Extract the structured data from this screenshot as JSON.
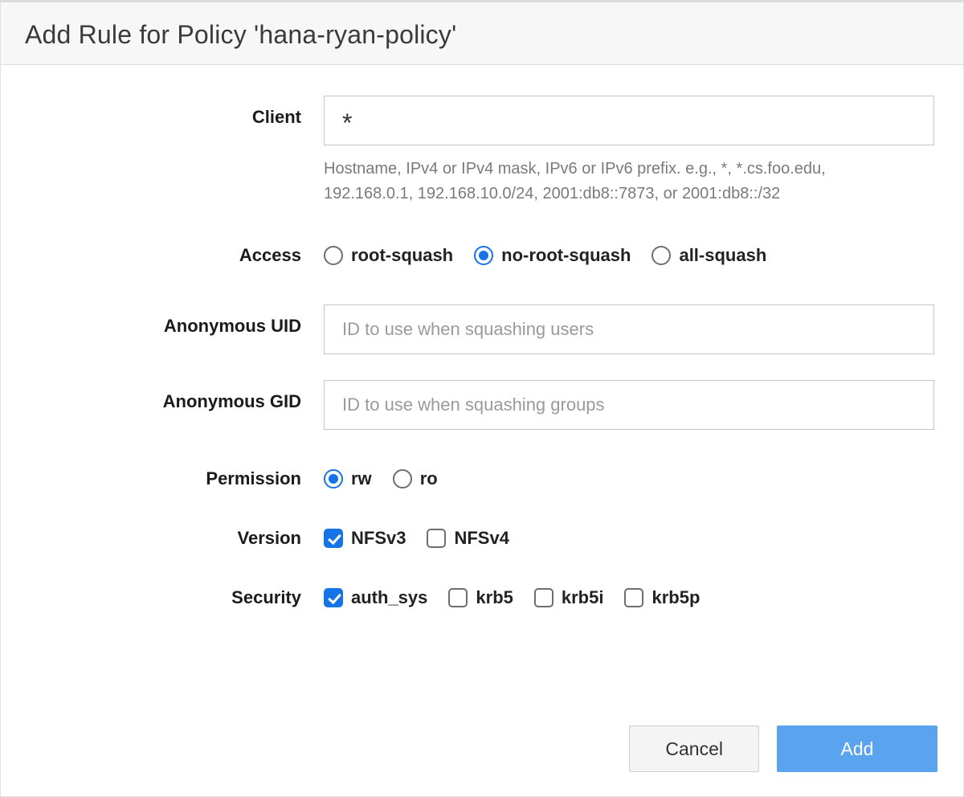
{
  "header": {
    "title": "Add Rule for Policy 'hana-ryan-policy'"
  },
  "fields": {
    "client": {
      "label": "Client",
      "value": "*",
      "hint": "Hostname, IPv4 or IPv4 mask, IPv6 or IPv6 prefix. e.g., *, *.cs.foo.edu, 192.168.0.1, 192.168.10.0/24, 2001:db8::7873, or 2001:db8::/32"
    },
    "access": {
      "label": "Access",
      "options": [
        {
          "value": "root-squash",
          "label": "root-squash"
        },
        {
          "value": "no-root-squash",
          "label": "no-root-squash"
        },
        {
          "value": "all-squash",
          "label": "all-squash"
        }
      ],
      "selected": "no-root-squash"
    },
    "anon_uid": {
      "label": "Anonymous UID",
      "value": "",
      "placeholder": "ID to use when squashing users"
    },
    "anon_gid": {
      "label": "Anonymous GID",
      "value": "",
      "placeholder": "ID to use when squashing groups"
    },
    "permission": {
      "label": "Permission",
      "options": [
        {
          "value": "rw",
          "label": "rw"
        },
        {
          "value": "ro",
          "label": "ro"
        }
      ],
      "selected": "rw"
    },
    "version": {
      "label": "Version",
      "options": [
        {
          "value": "nfsv3",
          "label": "NFSv3",
          "checked": true
        },
        {
          "value": "nfsv4",
          "label": "NFSv4",
          "checked": false
        }
      ]
    },
    "security": {
      "label": "Security",
      "options": [
        {
          "value": "auth_sys",
          "label": "auth_sys",
          "checked": true
        },
        {
          "value": "krb5",
          "label": "krb5",
          "checked": false
        },
        {
          "value": "krb5i",
          "label": "krb5i",
          "checked": false
        },
        {
          "value": "krb5p",
          "label": "krb5p",
          "checked": false
        }
      ]
    }
  },
  "buttons": {
    "cancel": "Cancel",
    "add": "Add"
  }
}
